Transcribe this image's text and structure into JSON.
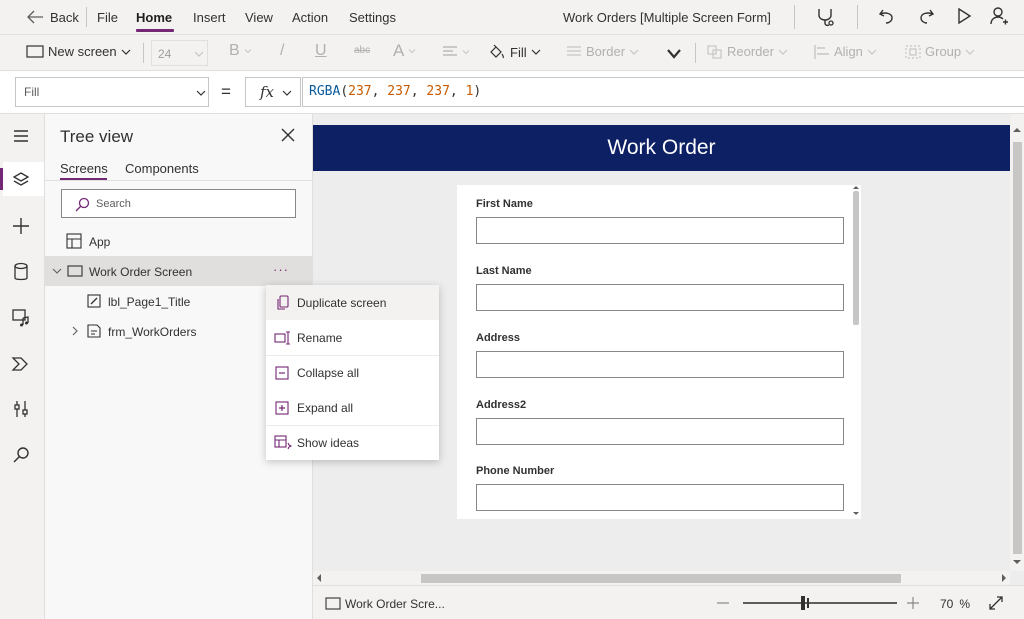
{
  "menu": {
    "back": "Back",
    "items": [
      "File",
      "Home",
      "Insert",
      "View",
      "Action",
      "Settings"
    ],
    "app_title": "Work Orders [Multiple Screen Form]"
  },
  "ribbon": {
    "new_screen": "New screen",
    "font_size": "24",
    "bold": "B",
    "italic": "/",
    "underline": "U",
    "strike": "abc",
    "font_color": "A",
    "fill": "Fill",
    "border": "Border",
    "reorder": "Reorder",
    "align": "Align",
    "group": "Group"
  },
  "formula": {
    "property": "Fill",
    "equals": "=",
    "fx": "fx",
    "fn": "RGBA",
    "open": "(",
    "args": [
      "237",
      "237",
      "237",
      "1"
    ],
    "close": ")"
  },
  "tree": {
    "title": "Tree view",
    "tabs": [
      "Screens",
      "Components"
    ],
    "search_placeholder": "Search",
    "app": "App",
    "screen": "Work Order Screen",
    "more": "···",
    "children": [
      "lbl_Page1_Title",
      "frm_WorkOrders"
    ]
  },
  "context_menu": [
    "Duplicate screen",
    "Rename",
    "Collapse all",
    "Expand all",
    "Show ideas"
  ],
  "canvas": {
    "header_title": "Work Order",
    "fields": [
      "First Name",
      "Last Name",
      "Address",
      "Address2",
      "Phone Number"
    ]
  },
  "status": {
    "screen_name": "Work Order Scre...",
    "zoom_value": "70",
    "zoom_unit": "%",
    "zoom_fraction": 0.4
  },
  "colors": {
    "accent": "#742774",
    "header_bg": "#0d2064",
    "canvas_bg": "#ededed",
    "number": "#c75b00",
    "fn": "#0b5a9c"
  }
}
